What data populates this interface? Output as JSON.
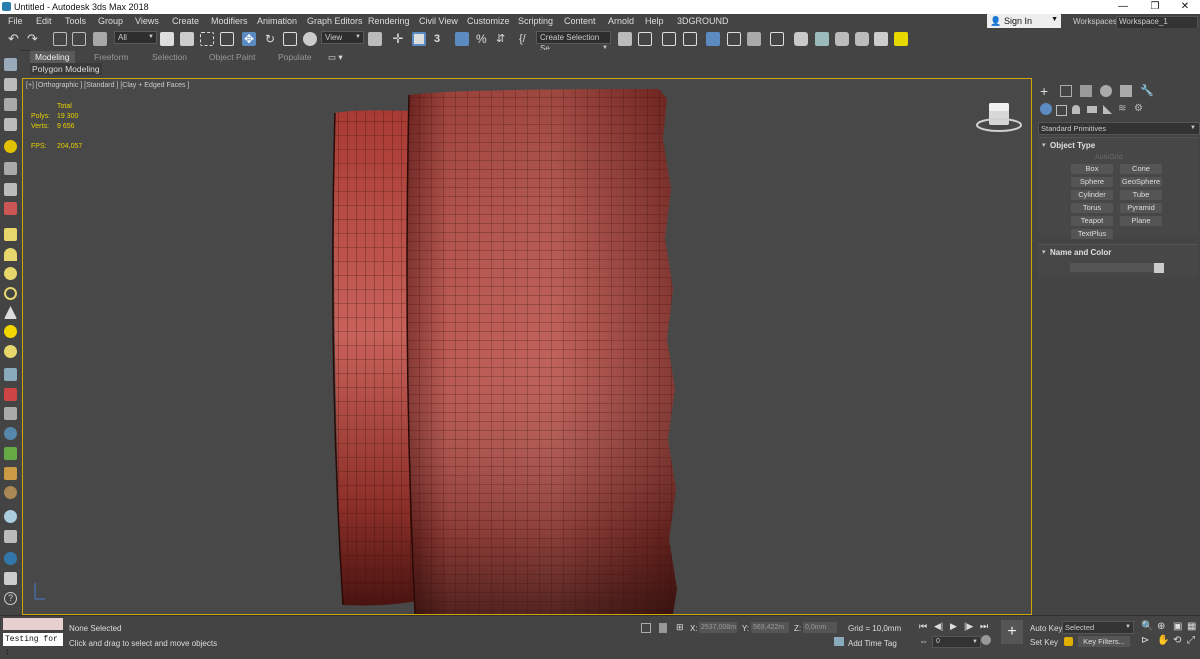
{
  "window": {
    "title": "Untitled - Autodesk 3ds Max 2018"
  },
  "menu": [
    "File",
    "Edit",
    "Tools",
    "Group",
    "Views",
    "Create",
    "Modifiers",
    "Animation",
    "Graph Editors",
    "Rendering",
    "Civil View",
    "Customize",
    "Scripting",
    "Content",
    "Arnold",
    "Help",
    "3DGROUND"
  ],
  "account": {
    "signin": "Sign In",
    "workspaces_label": "Workspaces:",
    "workspace": "Workspace_1"
  },
  "toolbar": {
    "filter": "All",
    "view": "View",
    "selection_set": "Create Selection Se"
  },
  "ribbon": {
    "tabs": [
      "Modeling",
      "Freeform",
      "Selection",
      "Object Paint",
      "Populate"
    ],
    "sub": "Polygon Modeling"
  },
  "viewport": {
    "label": "[+] [Orthographic ] [Standard ] [Clay + Edged Faces ]",
    "stats": {
      "total": "Total",
      "polys_label": "Polys:",
      "polys": "19 300",
      "verts_label": "Verts:",
      "verts": "9 656",
      "fps_label": "FPS:",
      "fps": "204,057"
    }
  },
  "command_panel": {
    "category": "Standard Primitives",
    "object_type_title": "Object Type",
    "autogrid": "AutoGrid",
    "primitives": [
      "Box",
      "Cone",
      "Sphere",
      "GeoSphere",
      "Cylinder",
      "Tube",
      "Torus",
      "Pyramid",
      "Teapot",
      "Plane",
      "TextPlus"
    ],
    "name_color_title": "Name and Color"
  },
  "status": {
    "script_listener": "Testing for :",
    "selection": "None Selected",
    "prompt": "Click and drag to select and move objects",
    "x_label": "X:",
    "x": "2537,008m",
    "y_label": "Y:",
    "y": "569,422m",
    "z_label": "Z:",
    "z": "0,0mm",
    "grid": "Grid = 10,0mm",
    "add_time_tag": "Add Time Tag",
    "frame": "0",
    "auto_key": "Auto Key",
    "auto_key_value": "Selected",
    "set_key": "Set Key",
    "key_filters": "Key Filters..."
  },
  "colors": {
    "accent": "#cfa600",
    "selected": "#5b8bc1",
    "mesh": "#b03a32"
  }
}
